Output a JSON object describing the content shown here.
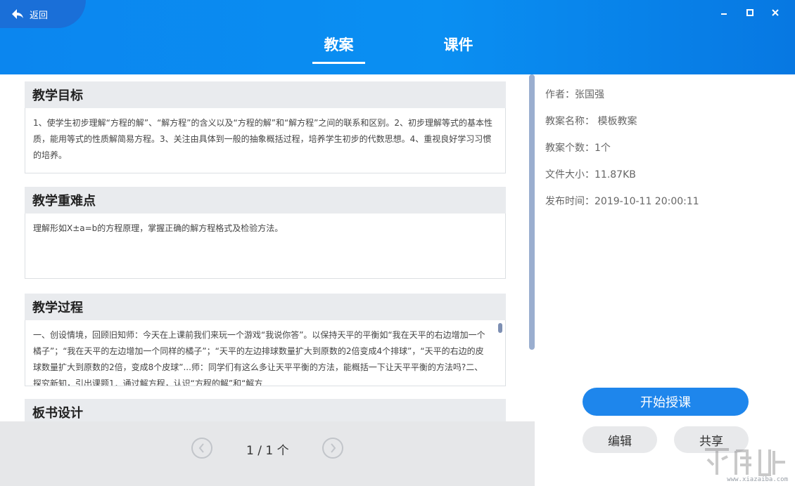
{
  "header": {
    "back_label": "返回",
    "tabs": [
      {
        "label": "教案",
        "active": true
      },
      {
        "label": "课件",
        "active": false
      }
    ]
  },
  "sections": [
    {
      "title": "教学目标",
      "body": "1、使学生初步理解“方程的解”、“解方程”的含义以及“方程的解”和“解方程”之间的联系和区别。2、初步理解等式的基本性质，能用等式的性质解简易方程。3、关注由具体到一般的抽象概括过程，培养学生初步的代数思想。4、重视良好学习习惯的培养。"
    },
    {
      "title": "教学重难点",
      "body": "理解形如X±a=b的方程原理，掌握正确的解方程格式及检验方法。"
    },
    {
      "title": "教学过程",
      "body": "一、创设情境，回顾旧知师：今天在上课前我们来玩一个游戏“我说你答”。以保持天平的平衡如“我在天平的右边增加一个橘子”；“我在天平的左边增加一个同样的橘子”；“天平的左边排球数量扩大到原数的2倍变成4个排球”，“天平的右边的皮球数量扩大到原数的2倍，变成8个皮球”...师：同学们有这么多让天平平衡的方法，能概括一下让天平平衡的方法吗?二、探究新知，引出课题1．通过解方程，认识“方程的解”和“解方"
    },
    {
      "title": "板书设计",
      "body": ""
    }
  ],
  "pager": {
    "text": "1 / 1 个"
  },
  "info": {
    "author": "作者：张国强",
    "name": "教案名称： 模板教案",
    "count": "教案个数：1个",
    "size": "文件大小：11.87KB",
    "time": "发布时间：2019-10-11 20:00:11"
  },
  "buttons": {
    "start": "开始授课",
    "edit": "编辑",
    "share": "共享"
  },
  "watermark": {
    "text": "www.xiazaiba.com"
  },
  "colors": {
    "header_blue": "#0b86ef",
    "accent": "#1e86ec"
  }
}
